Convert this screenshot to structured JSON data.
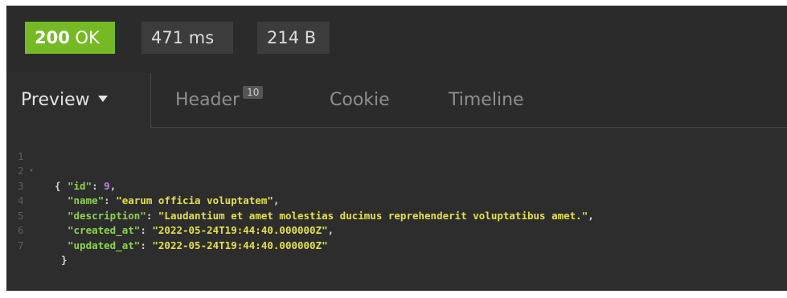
{
  "status_bar": {
    "status_code": "200",
    "status_text": "OK",
    "time": "471 ms",
    "size": "214 B"
  },
  "tabs": {
    "preview": "Preview",
    "header": "Header",
    "header_count": "10",
    "cookie": "Cookie",
    "timeline": "Timeline"
  },
  "code": {
    "line_numbers": [
      "1",
      "2",
      "3",
      "4",
      "5",
      "6",
      "7"
    ],
    "open_brace": "{",
    "close_brace": "}",
    "fields": [
      {
        "key": "\"id\"",
        "value": "9",
        "type": "number"
      },
      {
        "key": "\"name\"",
        "value": "\"earum officia voluptatem\"",
        "type": "string"
      },
      {
        "key": "\"description\"",
        "value": "\"Laudantium et amet molestias ducimus reprehenderit voluptatibus amet.\"",
        "type": "string"
      },
      {
        "key": "\"created_at\"",
        "value": "\"2022-05-24T19:44:40.000000Z\"",
        "type": "string"
      },
      {
        "key": "\"updated_at\"",
        "value": "\"2022-05-24T19:44:40.000000Z\"",
        "type": "string"
      }
    ]
  },
  "colors": {
    "status_ok": "#75ba24",
    "json_key": "#8fd14f",
    "json_string": "#e5e04a",
    "json_number": "#b784e8"
  }
}
